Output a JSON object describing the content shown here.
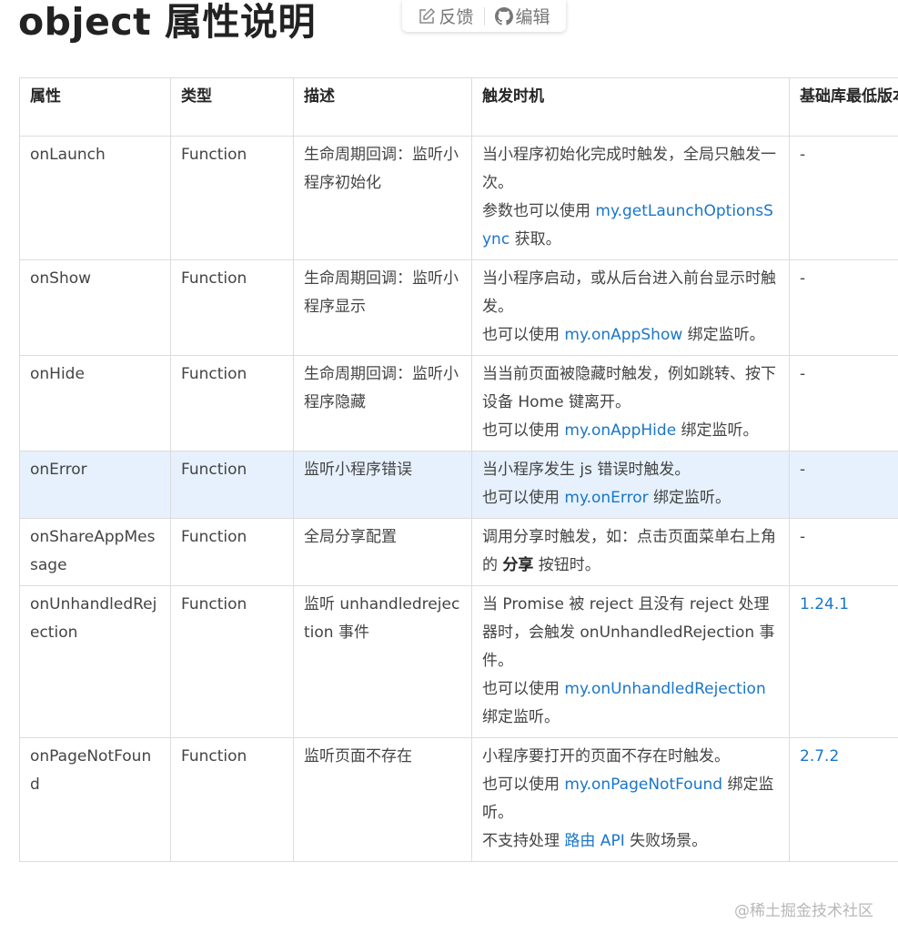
{
  "page": {
    "title": "object 属性说明",
    "toolbar": {
      "feedback_label": "反馈",
      "edit_label": "编辑"
    },
    "watermark": "@稀土掘金技术社区"
  },
  "table": {
    "headers": [
      "属性",
      "类型",
      "描述",
      "触发时机",
      "基础库最低版本"
    ],
    "rows": [
      {
        "name": "onLaunch",
        "type": "Function",
        "desc": "生命周期回调：监听小程序初始化",
        "trigger": [
          [
            {
              "t": "当小程序初始化完成时触发，全局只触发一次。"
            }
          ],
          [
            {
              "t": "参数也可以使用 "
            },
            {
              "t": "my.getLaunchOptionsSync",
              "link": true
            },
            {
              "t": " 获取。"
            }
          ]
        ],
        "version": "-"
      },
      {
        "name": "onShow",
        "type": "Function",
        "desc": "生命周期回调：监听小程序显示",
        "trigger": [
          [
            {
              "t": "当小程序启动，或从后台进入前台显示时触发。"
            }
          ],
          [
            {
              "t": "也可以使用 "
            },
            {
              "t": "my.onAppShow",
              "link": true
            },
            {
              "t": " 绑定监听。"
            }
          ]
        ],
        "version": "-"
      },
      {
        "name": "onHide",
        "type": "Function",
        "desc": "生命周期回调：监听小程序隐藏",
        "trigger": [
          [
            {
              "t": "当当前页面被隐藏时触发，例如跳转、按下设备 Home 键离开。"
            }
          ],
          [
            {
              "t": "也可以使用 "
            },
            {
              "t": "my.onAppHide",
              "link": true
            },
            {
              "t": " 绑定监听。"
            }
          ]
        ],
        "version": "-"
      },
      {
        "name": "onError",
        "type": "Function",
        "desc": "监听小程序错误",
        "trigger": [
          [
            {
              "t": "当小程序发生 js 错误时触发。"
            }
          ],
          [
            {
              "t": "也可以使用 "
            },
            {
              "t": "my.onError",
              "link": true
            },
            {
              "t": " 绑定监听。"
            }
          ]
        ],
        "version": "-",
        "highlight": true
      },
      {
        "name": "onShareAppMessage",
        "type": "Function",
        "desc": "全局分享配置",
        "trigger": [
          [
            {
              "t": "调用分享时触发，如：点击页面菜单右上角的 "
            },
            {
              "t": "分享",
              "bold": true
            },
            {
              "t": " 按钮时。"
            }
          ]
        ],
        "version": "-"
      },
      {
        "name": "onUnhandledRejection",
        "type": "Function",
        "desc": "监听 unhandledrejection 事件",
        "trigger": [
          [
            {
              "t": "当 Promise 被 reject 且没有 reject 处理器时，会触发 onUnhandledRejection 事件。"
            }
          ],
          [
            {
              "t": "也可以使用 "
            },
            {
              "t": "my.onUnhandledRejection",
              "link": true
            },
            {
              "t": " 绑定监听。"
            }
          ]
        ],
        "version": "1.24.1",
        "version_link": true
      },
      {
        "name": "onPageNotFound",
        "type": "Function",
        "desc": "监听页面不存在",
        "trigger": [
          [
            {
              "t": "小程序要打开的页面不存在时触发。"
            }
          ],
          [
            {
              "t": "也可以使用 "
            },
            {
              "t": "my.onPageNotFound",
              "link": true
            },
            {
              "t": " 绑定监听。"
            }
          ],
          [
            {
              "t": "不支持处理 "
            },
            {
              "t": "路由 API",
              "link": true
            },
            {
              "t": " 失败场景。"
            }
          ]
        ],
        "version": "2.7.2",
        "version_link": true
      }
    ]
  },
  "colors": {
    "link": "#1a76c8",
    "highlight_row": "#e6f1fd",
    "border": "#dcdcdc"
  },
  "icons": {
    "feedback": "edit-icon",
    "edit": "github-icon"
  }
}
